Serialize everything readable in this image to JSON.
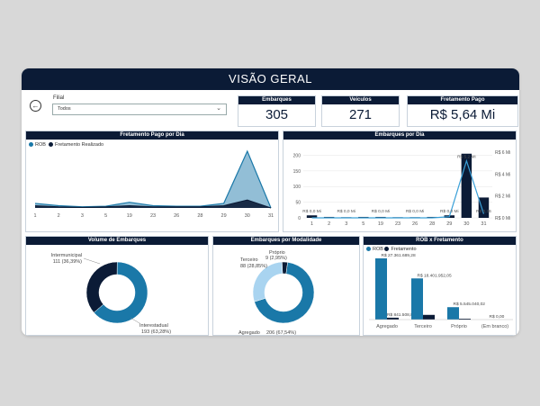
{
  "header": {
    "title": "VISÃO GERAL"
  },
  "filter": {
    "label": "Filial",
    "value": "Todos"
  },
  "kpis": [
    {
      "label": "Embarques",
      "value": "305"
    },
    {
      "label": "Veículos",
      "value": "271"
    },
    {
      "label": "Fretamento Pago",
      "value": "R$ 5,64 Mi"
    }
  ],
  "fretamento_dia": {
    "title": "Fretamento Pago por Dia",
    "legend": [
      {
        "label": "ROB",
        "color": "#1a78a8"
      },
      {
        "label": "Fretamento Realizado",
        "color": "#0b1b36"
      }
    ],
    "x_ticks": [
      "1",
      "2",
      "3",
      "5",
      "19",
      "23",
      "26",
      "28",
      "29",
      "30",
      "31"
    ]
  },
  "embarques_dia": {
    "title": "Embarques por Dia",
    "y_left": [
      "200",
      "150",
      "100",
      "50",
      "0"
    ],
    "y_right": [
      "R$ 6 Mi",
      "R$ 4 Mi",
      "R$ 2 Mi",
      "R$ 0 Mi"
    ],
    "x_ticks": [
      "1",
      "2",
      "3",
      "5",
      "19",
      "23",
      "26",
      "28",
      "29",
      "30",
      "31"
    ],
    "value_labels": [
      "R$ 0,0 Mi",
      "R$ 0,0 Mi",
      "R$ 0,0 Mi",
      "R$ 0,0 Mi",
      "R$ 0,0 Mi",
      "R$ 5,2 Mi",
      "R$ 0,36"
    ]
  },
  "volume": {
    "title": "Volume de Embarques",
    "slices": [
      {
        "name": "Intermunicipal",
        "detail": "111 (36,39%)",
        "pct": 36.39,
        "color": "#0b1b36"
      },
      {
        "name": "Interestadual",
        "detail": "193 (63,28%)",
        "pct": 63.28,
        "color": "#1a78a8"
      }
    ]
  },
  "modalidade": {
    "title": "Embarques por Modalidade",
    "slices": [
      {
        "name": "Agregado",
        "detail": "206 (67,54%)",
        "pct": 67.54,
        "color": "#1a78a8"
      },
      {
        "name": "Terceiro",
        "detail": "88 (28,85%)",
        "pct": 28.85,
        "color": "#a9d4f0"
      },
      {
        "name": "Próprio",
        "detail": "9 (2,95%)",
        "pct": 2.95,
        "color": "#0b1b36"
      }
    ]
  },
  "rob_fretamento": {
    "title": "ROB x Fretamento",
    "legend": [
      {
        "label": "ROB",
        "color": "#1a78a8"
      },
      {
        "label": "Fretamento",
        "color": "#0b1b36"
      }
    ],
    "categories": [
      "Agregado",
      "Terceiro",
      "Próprio",
      "(Em branco)"
    ],
    "rob_labels": [
      "R$ 27.361.689,28",
      "R$ 18.401.952,05",
      "R$ 5.545.040,02",
      "R$ 0,00"
    ],
    "fret_labels": [
      "R$ 841.508,88",
      "",
      "",
      ""
    ]
  },
  "chart_data": [
    {
      "type": "area",
      "title": "Fretamento Pago por Dia",
      "categories": [
        "1",
        "2",
        "3",
        "5",
        "19",
        "23",
        "26",
        "28",
        "29",
        "30",
        "31"
      ],
      "series": [
        {
          "name": "ROB",
          "values": [
            0.08,
            0.04,
            0.02,
            0.03,
            0.1,
            0.04,
            0.03,
            0.03,
            0.08,
            1.0,
            0.0
          ]
        },
        {
          "name": "Fretamento Realizado",
          "values": [
            0.04,
            0.02,
            0.01,
            0.02,
            0.04,
            0.02,
            0.02,
            0.02,
            0.04,
            0.14,
            0.0
          ]
        }
      ]
    },
    {
      "type": "bar",
      "title": "Embarques por Dia",
      "categories": [
        "1",
        "2",
        "3",
        "5",
        "19",
        "23",
        "26",
        "28",
        "29",
        "30",
        "31"
      ],
      "series": [
        {
          "name": "Embarques",
          "values": [
            8,
            3,
            2,
            3,
            3,
            2,
            2,
            3,
            8,
            205,
            65
          ]
        },
        {
          "name": "Fretamento",
          "values": [
            0.0,
            0.0,
            0.0,
            0.0,
            0.0,
            0.0,
            0.0,
            0.0,
            0.1,
            5.2,
            0.36
          ]
        }
      ],
      "ylim": [
        0,
        210
      ],
      "y2lim": [
        0,
        6
      ]
    },
    {
      "type": "pie",
      "title": "Volume de Embarques",
      "categories": [
        "Intermunicipal",
        "Interestadual"
      ],
      "values": [
        111,
        193
      ]
    },
    {
      "type": "pie",
      "title": "Embarques por Modalidade",
      "categories": [
        "Agregado",
        "Terceiro",
        "Próprio"
      ],
      "values": [
        206,
        88,
        9
      ]
    },
    {
      "type": "bar",
      "title": "ROB x Fretamento",
      "categories": [
        "Agregado",
        "Terceiro",
        "Próprio",
        "(Em branco)"
      ],
      "series": [
        {
          "name": "ROB",
          "values": [
            27361689.28,
            18401952.05,
            5545040.02,
            0
          ]
        },
        {
          "name": "Fretamento",
          "values": [
            841508.88,
            2100000,
            400000,
            0
          ]
        }
      ]
    }
  ]
}
